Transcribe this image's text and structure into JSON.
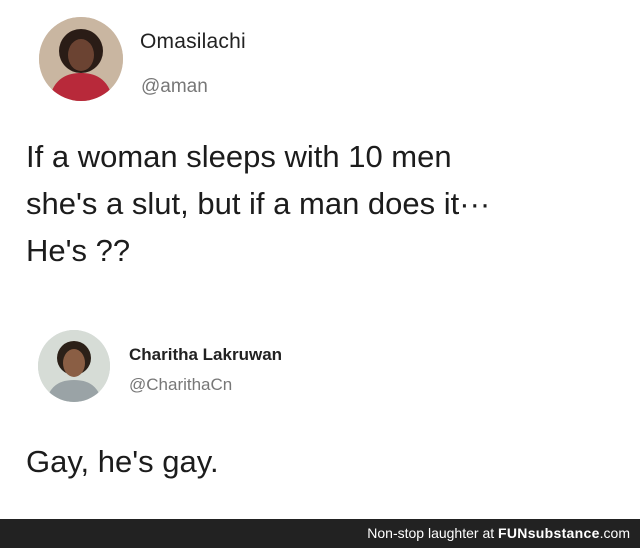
{
  "tweets": [
    {
      "display_name": "Omasilachi",
      "handle": "@aman",
      "text": "If a woman sleeps with 10 men\nshe's a slut, but if a man does it···\nHe's ??"
    },
    {
      "display_name": "Charitha Lakruwan",
      "handle": "@CharithaCn",
      "text": "Gay, he's gay."
    }
  ],
  "footer": {
    "prefix": "Non-stop laughter at ",
    "brand_fun": "FUN",
    "brand_substance": "substance",
    "brand_tld": ".com"
  }
}
